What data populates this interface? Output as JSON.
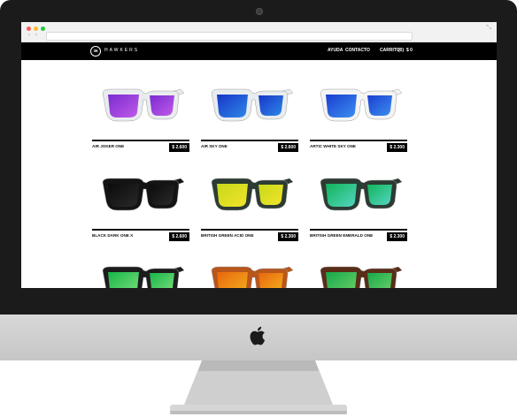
{
  "site": {
    "logo_mark": "36",
    "logo_text": "HAWKERS",
    "nav_help": "AYUDA",
    "nav_contact": "CONTACTO",
    "cart_label": "CARRITO",
    "cart_count": "(0)",
    "cart_total": "$ 0"
  },
  "browser": {
    "back": "‹",
    "forward": "›",
    "expand_icon": "expand-icon"
  },
  "products": [
    {
      "name": "AIR JOKER ONE",
      "price": "$ 2.600",
      "frame": "#e9ecef",
      "lens": "#7a2bd1",
      "lens2": "#c05be8"
    },
    {
      "name": "AIR SKY ONE",
      "price": "$ 2.600",
      "frame": "#e9ecef",
      "lens": "#1636c8",
      "lens2": "#2f88e8"
    },
    {
      "name": "ARTIC WHITE SKY ONE",
      "price": "$ 2.300",
      "frame": "#f4f4f4",
      "lens": "#1a3ed0",
      "lens2": "#3c8ff0"
    },
    {
      "name": "BLACK DARK ONE X",
      "price": "$ 2.600",
      "frame": "#141414",
      "lens": "#0b0b0b",
      "lens2": "#2a2a2a"
    },
    {
      "name": "BRITISH GREEN ACID ONE",
      "price": "$ 2.300",
      "frame": "#2c3b33",
      "lens": "#c7d81b",
      "lens2": "#f2e42a"
    },
    {
      "name": "BRITISH GREEN EMERALD ONE",
      "price": "$ 2.300",
      "frame": "#2c3b33",
      "lens": "#12b35a",
      "lens2": "#55d6c2"
    },
    {
      "name": "",
      "price": "",
      "frame": "#1c1c1c",
      "lens": "#17b548",
      "lens2": "#7ee07e"
    },
    {
      "name": "",
      "price": "",
      "frame": "#b8561c",
      "lens": "#e8660f",
      "lens2": "#f4b21c"
    },
    {
      "name": "",
      "price": "",
      "frame": "#5a2d18",
      "lens": "#17a84a",
      "lens2": "#6ed26a"
    }
  ]
}
